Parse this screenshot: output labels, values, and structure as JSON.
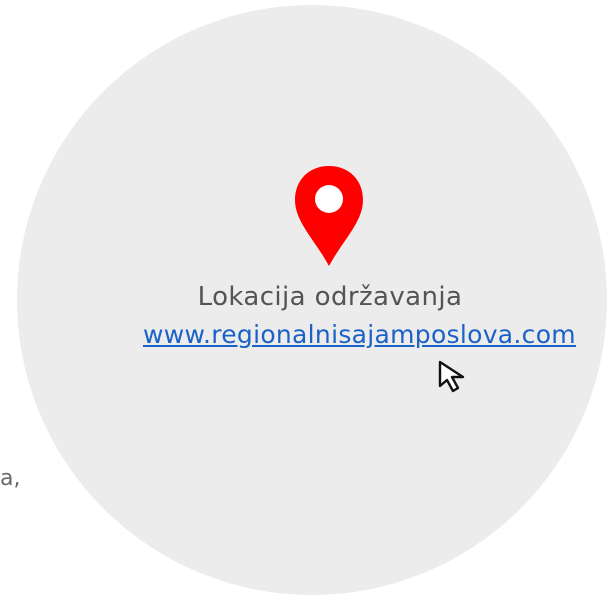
{
  "left_fragment": "a,",
  "location": {
    "label": "Lokacija održavanja",
    "url": "www.regionalnisajamposlova.com"
  },
  "icons": {
    "pin": "location-pin-icon",
    "cursor": "mouse-pointer-icon"
  },
  "colors": {
    "circle": "#ececec",
    "pin": "#ff0000",
    "link": "#1a61c8",
    "text": "#545454"
  }
}
